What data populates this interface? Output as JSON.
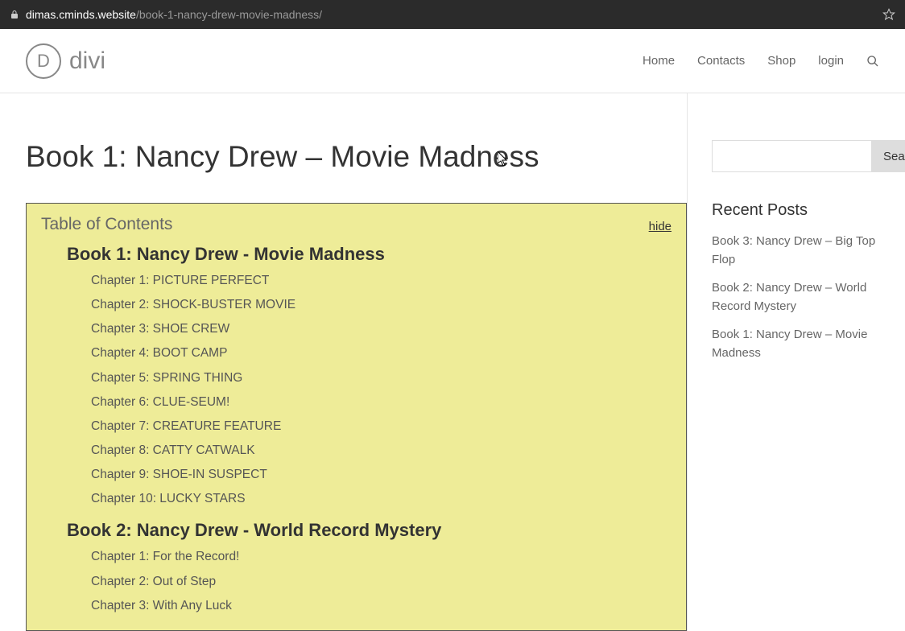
{
  "browser": {
    "domain": "dimas.cminds.website",
    "path": "/book-1-nancy-drew-movie-madness/"
  },
  "header": {
    "logo_letter": "D",
    "logo_text": "divi",
    "nav": [
      "Home",
      "Contacts",
      "Shop",
      "login"
    ]
  },
  "page_title": "Book 1: Nancy Drew – Movie Madness",
  "toc": {
    "title": "Table of Contents",
    "hide_label": "hide",
    "books": [
      {
        "title": "Book 1: Nancy Drew - Movie Madness",
        "chapters": [
          "Chapter 1: PICTURE PERFECT",
          "Chapter 2: SHOCK-BUSTER MOVIE",
          "Chapter 3: SHOE CREW",
          "Chapter 4: BOOT CAMP",
          "Chapter 5: SPRING THING",
          "Chapter 6: CLUE-SEUM!",
          "Chapter 7: CREATURE FEATURE",
          "Chapter 8: CATTY CATWALK",
          "Chapter 9: SHOE-IN SUSPECT",
          "Chapter 10: LUCKY STARS"
        ]
      },
      {
        "title": "Book 2: Nancy Drew - World Record Mystery",
        "chapters": [
          "Chapter 1: For the Record!",
          "Chapter 2: Out of Step",
          "Chapter 3: With Any Luck"
        ]
      }
    ]
  },
  "sidebar": {
    "search_button": "Search",
    "recent_title": "Recent Posts",
    "recent_posts": [
      "Book 3: Nancy Drew – Big Top Flop",
      "Book 2: Nancy Drew – World Record Mystery",
      "Book 1: Nancy Drew – Movie Madness"
    ]
  }
}
